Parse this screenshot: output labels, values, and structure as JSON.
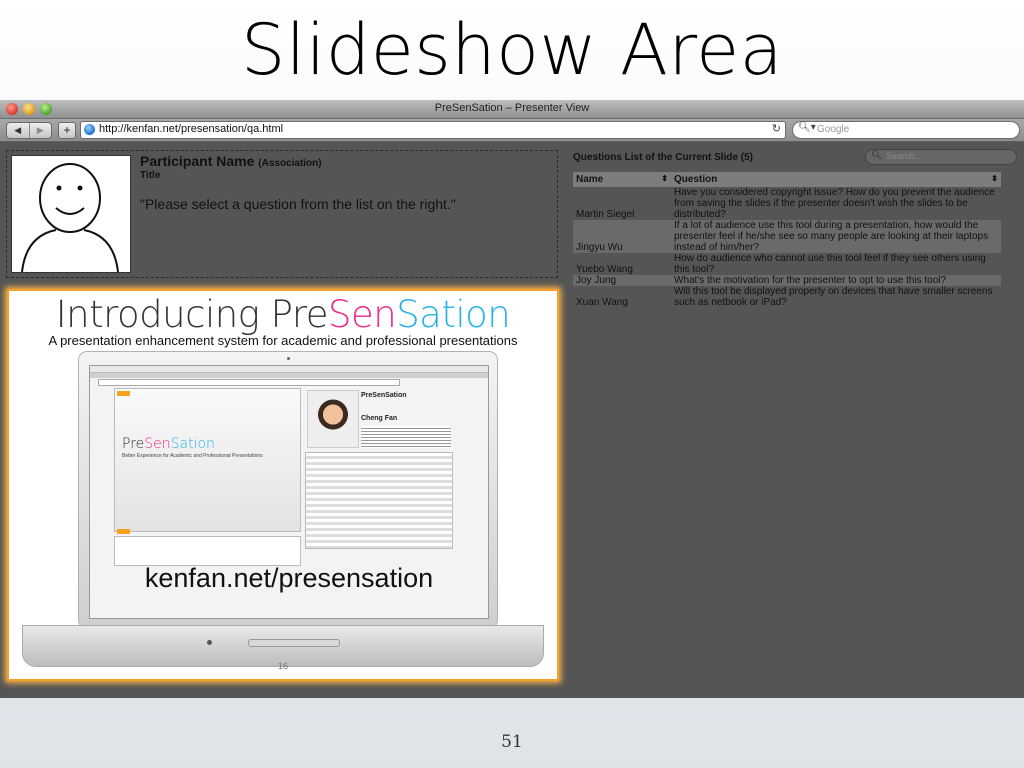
{
  "slide": {
    "title": "Slideshow Area",
    "page_number": "51"
  },
  "window": {
    "title": "PreSenSation – Presenter View",
    "url": "http://kenfan.net/presensation/qa.html",
    "search_placeholder": "Google"
  },
  "participant": {
    "name": "Participant Name",
    "association": "(Association)",
    "title": "Title",
    "prompt": "\"Please select a question from the list on the right.\""
  },
  "current_slide": {
    "heading_prefix": "Introducing ",
    "brand_pre": "Pre",
    "brand_sen": "Sen",
    "brand_sation": "Sation",
    "tagline": "A presentation enhancement system for academic and professional presentations",
    "url_text": "kenfan.net/presensation",
    "slide_number": "16",
    "screen_brand_pre": "Pre",
    "screen_brand_sen": "Sen",
    "screen_brand_sation": "Sation",
    "screen_subtitle": "Better Experience for Academic and Professional Presentations",
    "screen_name": "PreSenSation",
    "screen_presenter": "Cheng Fan",
    "brand_colors": {
      "pre": "#333333",
      "sen": "#ee2b8b",
      "sation": "#26b2e8"
    }
  },
  "questions": {
    "header": "Questions List of the Current Slide (5)",
    "search_placeholder": "Search...",
    "columns": [
      "Name",
      "Question"
    ],
    "rows": [
      {
        "name": "Martin Siegel",
        "question": "Have you considered copyright issue? How do you prevent the audience from saving the slides if the presenter doesn't wish the slides to be distributed?"
      },
      {
        "name": "Jingyu Wu",
        "question": "If a lot of audience use this tool during a presentation, how would the presenter feel if he/she see so many people are looking at their laptops instead of him/her?"
      },
      {
        "name": "Yuebo Wang",
        "question": "How do audience who cannot use this tool feel if they see others using this tool?"
      },
      {
        "name": "Joy Jung",
        "question": "What's the motivation for the presenter to opt to use this tool?"
      },
      {
        "name": "Xuan Wang",
        "question": "Will this tool be displayed properly on devices that have smaller screens such as netbook or iPad?"
      }
    ]
  },
  "accent_color": "#f6a02a"
}
